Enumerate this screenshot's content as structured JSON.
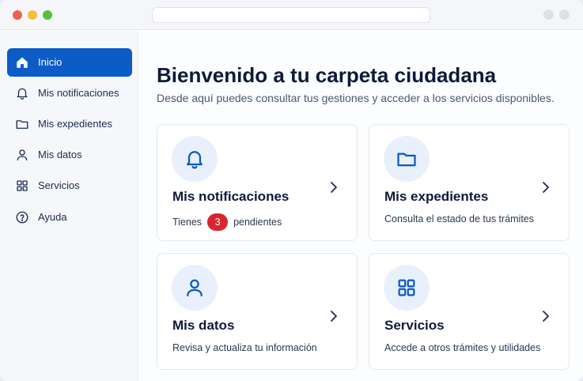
{
  "sidebar": {
    "items": [
      {
        "label": "Inicio",
        "icon": "home-icon",
        "active": true
      },
      {
        "label": "Mis notificaciones",
        "icon": "bell-icon"
      },
      {
        "label": "Mis expedientes",
        "icon": "folder-icon"
      },
      {
        "label": "Mis datos",
        "icon": "user-icon"
      },
      {
        "label": "Servicios",
        "icon": "grid-icon"
      },
      {
        "label": "Ayuda",
        "icon": "help-icon"
      }
    ]
  },
  "main": {
    "title": "Bienvenido a tu carpeta ciudadana",
    "subtitle": "Desde aquí puedes consultar tus gestiones y acceder a los servicios disponibles.",
    "cards": [
      {
        "title": "Mis notificaciones",
        "desc_prefix": "Tienes",
        "badge": "3",
        "desc_suffix": "pendientes",
        "icon": "bell-icon"
      },
      {
        "title": "Mis expedientes",
        "desc": "Consulta el estado de tus trámites",
        "icon": "folder-icon"
      },
      {
        "title": "Mis datos",
        "desc": "Revisa y actualiza tu información",
        "icon": "user-icon"
      },
      {
        "title": "Servicios",
        "desc": "Accede a otros trámites y utilidades",
        "icon": "grid-icon"
      }
    ]
  },
  "colors": {
    "accent": "#0b5cc7",
    "badge": "#d7262f",
    "icon_blue": "#0b57c2",
    "icon_circle": "#e8f0fb"
  }
}
